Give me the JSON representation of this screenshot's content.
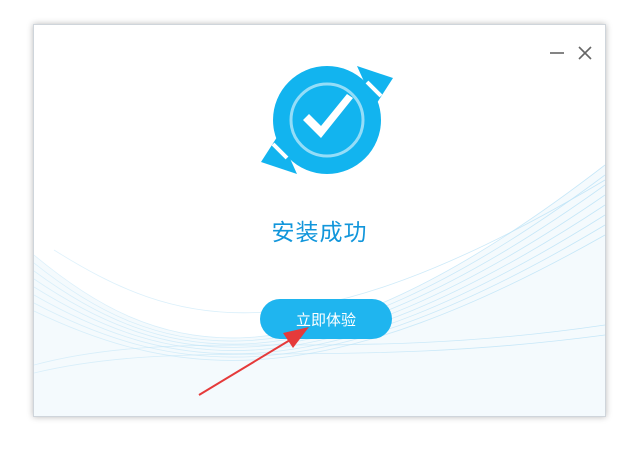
{
  "window": {
    "status_title": "安装成功",
    "primary_button_label": "立即体验",
    "controls": {
      "minimize_icon": "minimize-icon",
      "close_icon": "close-icon"
    }
  },
  "logo": {
    "icon": "checkmark-refresh-icon"
  },
  "colors": {
    "accent": "#1296db",
    "button": "#1fb5ef",
    "logo": "#12b4ef",
    "annotation_arrow": "#e53a3a"
  }
}
